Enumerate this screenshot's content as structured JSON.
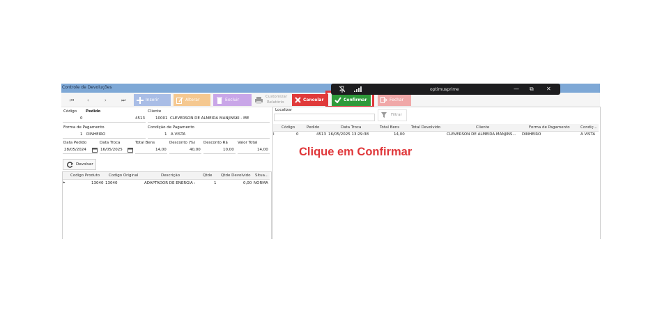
{
  "window": {
    "title": "Controle de Devoluções"
  },
  "toolbar": {
    "nav": [
      "⏮",
      "‹",
      "›",
      "⏭"
    ],
    "inserir": "Inserir",
    "alterar": "Alterar",
    "excluir": "Excluir",
    "customizar": "Customizar",
    "relatorio": "Relatório",
    "cancelar": "Cancelar",
    "confirmar": "Confirmar",
    "fechar": "Fechar"
  },
  "form": {
    "codigo_label": "Código",
    "codigo_value": "0",
    "pedido_label": "Pedido",
    "pedido_value": "4513",
    "cliente_label": "Cliente",
    "cliente_code": "10001",
    "cliente_name": "CLEVERSON DE ALMEIDA MANJINSKI - ME",
    "forma_label": "Forma de Pagamento",
    "forma_code": "1",
    "forma_value": "DINHEIRO",
    "condicao_label": "Condição de Pagamento",
    "condicao_code": "1",
    "condicao_value": "A VISTA",
    "data_pedido_label": "Data Pedido",
    "data_pedido_value": "28/05/2024",
    "data_troca_label": "Data Troca",
    "data_troca_value": "16/05/2025",
    "total_bens_label": "Total Bens",
    "total_bens_value": "14,00",
    "desconto_pct_label": "Desconto (%)",
    "desconto_pct_value": "40,00",
    "desconto_rs_label": "Desconto R$",
    "desconto_rs_value": "10,00",
    "valor_total_label": "Valor Total",
    "valor_total_value": "14,00",
    "devolver_label": "Devolver"
  },
  "items_table": {
    "headers": [
      "Codigo Produto",
      "Codigo Original",
      "Descrição",
      "Qtde",
      "Qtde Devolvido",
      "Situa..."
    ],
    "row": {
      "indicator": "▸",
      "codigo_produto": "13040",
      "codigo_original": "13040",
      "descricao": "ADAPTADOR DE ENERGIA :",
      "qtde": "1",
      "qtde_devolvido": "0,00",
      "situacao": "NORMA"
    }
  },
  "search": {
    "localizar_label": "Localizar",
    "filtrar_label": "Filtrar"
  },
  "grid": {
    "headers": [
      "Código",
      "Pedido",
      "Data Troca",
      "Total Bens",
      "Total Devolvido",
      "Cliente",
      "Forma de Pagamento",
      "Condiç..."
    ],
    "row": {
      "indicator": "I",
      "codigo": "0",
      "pedido": "4513",
      "data_troca": "16/05/2025 13:29:38",
      "total_bens": "14,00",
      "total_devolvido": "",
      "cliente": "CLEVERSON DE ALMEIDA MANJINS...",
      "forma": "DINHEIRO",
      "condicao": "A VISTA"
    }
  },
  "overlay": {
    "app_name": "optimusprime",
    "minimize": "—",
    "restore": "⧉",
    "close": "✕"
  },
  "annotation": {
    "text": "Clique em Confirmar",
    "color": "#e0373a"
  },
  "colors": {
    "titlebar": "#7ea8d6",
    "inserir": "#a9bde6",
    "alterar": "#f5c890",
    "excluir": "#c9a6e8",
    "cancelar": "#e03a3a",
    "confirmar": "#2e9a3a",
    "fechar": "#f0a8a8"
  }
}
